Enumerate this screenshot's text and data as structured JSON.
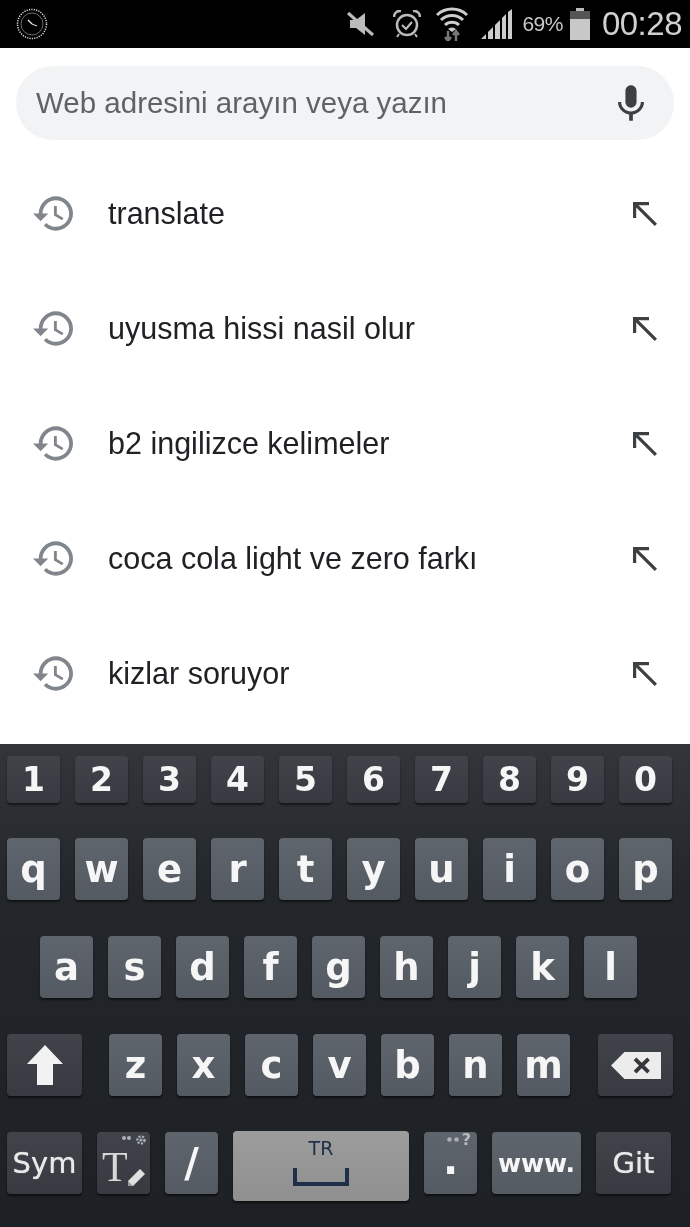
{
  "status_bar": {
    "battery": "69%",
    "time": "00:28"
  },
  "search": {
    "placeholder": "Web adresini arayın veya yazın"
  },
  "suggestions": [
    {
      "text": "translate"
    },
    {
      "text": "uyusma hissi nasil olur"
    },
    {
      "text": "b2 ingilizce kelimeler"
    },
    {
      "text": "coca cola light ve zero farkı"
    },
    {
      "text": "kizlar soruyor"
    }
  ],
  "keyboard": {
    "rows": [
      {
        "keys": [
          {
            "kind": "number",
            "label": "1"
          },
          {
            "kind": "number",
            "label": "2"
          },
          {
            "kind": "number",
            "label": "3"
          },
          {
            "kind": "number",
            "label": "4"
          },
          {
            "kind": "number",
            "label": "5"
          },
          {
            "kind": "number",
            "label": "6"
          },
          {
            "kind": "number",
            "label": "7"
          },
          {
            "kind": "number",
            "label": "8"
          },
          {
            "kind": "number",
            "label": "9"
          },
          {
            "kind": "number",
            "label": "0"
          }
        ]
      },
      {
        "keys": [
          {
            "kind": "letter",
            "label": "q"
          },
          {
            "kind": "letter",
            "label": "w"
          },
          {
            "kind": "letter",
            "label": "e"
          },
          {
            "kind": "letter",
            "label": "r"
          },
          {
            "kind": "letter",
            "label": "t"
          },
          {
            "kind": "letter",
            "label": "y"
          },
          {
            "kind": "letter",
            "label": "u"
          },
          {
            "kind": "letter",
            "label": "i"
          },
          {
            "kind": "letter",
            "label": "o"
          },
          {
            "kind": "letter",
            "label": "p"
          }
        ]
      },
      {
        "keys": [
          {
            "kind": "letter",
            "label": "a"
          },
          {
            "kind": "letter",
            "label": "s"
          },
          {
            "kind": "letter",
            "label": "d"
          },
          {
            "kind": "letter",
            "label": "f"
          },
          {
            "kind": "letter",
            "label": "g"
          },
          {
            "kind": "letter",
            "label": "h"
          },
          {
            "kind": "letter",
            "label": "j"
          },
          {
            "kind": "letter",
            "label": "k"
          },
          {
            "kind": "letter",
            "label": "l"
          }
        ]
      },
      {
        "keys": [
          {
            "kind": "shift"
          },
          {
            "kind": "letter",
            "label": "z"
          },
          {
            "kind": "letter",
            "label": "x"
          },
          {
            "kind": "letter",
            "label": "c"
          },
          {
            "kind": "letter",
            "label": "v"
          },
          {
            "kind": "letter",
            "label": "b"
          },
          {
            "kind": "letter",
            "label": "n"
          },
          {
            "kind": "letter",
            "label": "m"
          },
          {
            "kind": "backspace"
          }
        ]
      },
      {
        "keys": [
          {
            "kind": "function",
            "label": "Sym"
          },
          {
            "kind": "input-settings",
            "label": "T"
          },
          {
            "kind": "symbol",
            "label": "/"
          },
          {
            "kind": "space",
            "label": "TR"
          },
          {
            "kind": "period",
            "label": ".",
            "secondary": "?"
          },
          {
            "kind": "shortcut",
            "label": "www."
          },
          {
            "kind": "function",
            "label": "Git"
          }
        ]
      }
    ]
  }
}
